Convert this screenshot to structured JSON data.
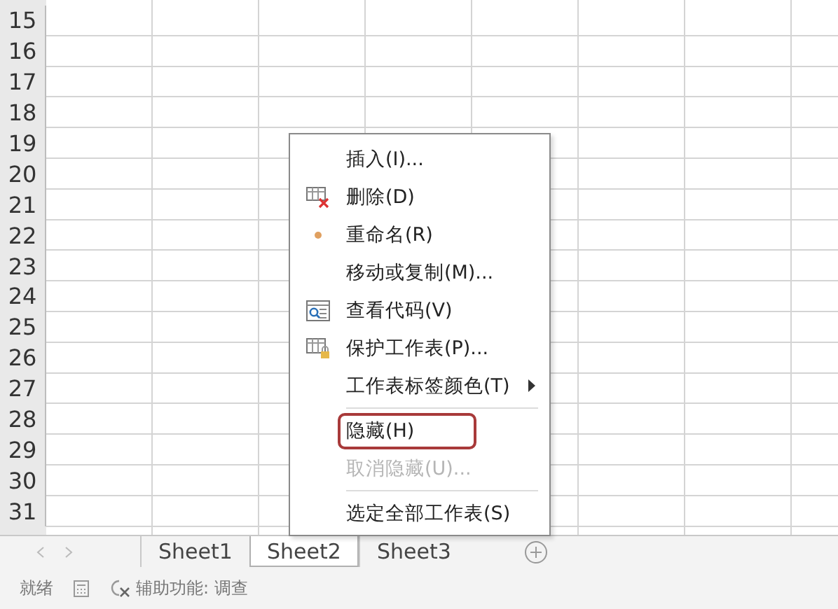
{
  "rows": [
    "15",
    "16",
    "17",
    "18",
    "19",
    "20",
    "21",
    "22",
    "23",
    "24",
    "25",
    "26",
    "27",
    "28",
    "29",
    "30",
    "31"
  ],
  "context_menu": {
    "items": [
      {
        "label": "插入(I)...",
        "kind": "plain",
        "disabled": false,
        "submenu": false,
        "highlighted": false
      },
      {
        "label": "删除(D)",
        "kind": "table-delete",
        "disabled": false,
        "submenu": false,
        "highlighted": false
      },
      {
        "label": "重命名(R)",
        "kind": "dot",
        "disabled": false,
        "submenu": false,
        "highlighted": false
      },
      {
        "label": "移动或复制(M)...",
        "kind": "plain",
        "disabled": false,
        "submenu": false,
        "highlighted": false
      },
      {
        "label": "查看代码(V)",
        "kind": "code",
        "disabled": false,
        "submenu": false,
        "highlighted": false
      },
      {
        "label": "保护工作表(P)...",
        "kind": "protect",
        "disabled": false,
        "submenu": false,
        "highlighted": false
      },
      {
        "label": "工作表标签颜色(T)",
        "kind": "plain",
        "disabled": false,
        "submenu": true,
        "highlighted": false
      },
      {
        "kind": "separator"
      },
      {
        "label": "隐藏(H)",
        "kind": "plain",
        "disabled": false,
        "submenu": false,
        "highlighted": true
      },
      {
        "label": "取消隐藏(U)...",
        "kind": "plain",
        "disabled": true,
        "submenu": false,
        "highlighted": false
      },
      {
        "kind": "separator"
      },
      {
        "label": "选定全部工作表(S)",
        "kind": "plain",
        "disabled": false,
        "submenu": false,
        "highlighted": false
      }
    ]
  },
  "sheet_tabs": [
    {
      "label": "Sheet1",
      "selected": false
    },
    {
      "label": "Sheet2",
      "selected": true
    },
    {
      "label": "Sheet3",
      "selected": false
    }
  ],
  "status_bar": {
    "status": "就绪",
    "accessibility": "辅助功能: 调查"
  }
}
